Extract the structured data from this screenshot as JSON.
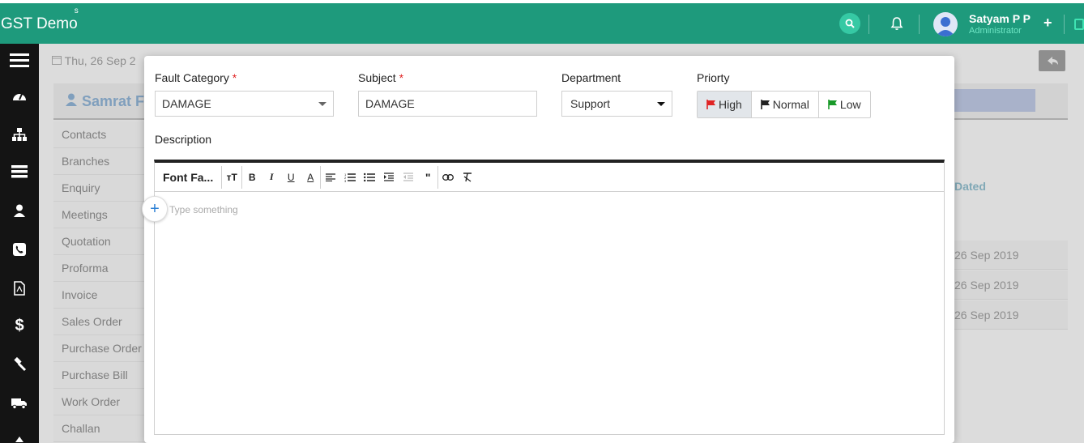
{
  "header": {
    "brand": "GST Demo",
    "brand_sup": "s",
    "user_name": "Satyam P P",
    "user_role": "Administrator",
    "accent": "#1e9a7c"
  },
  "sidebar": {
    "icons": [
      "menu-icon",
      "dashboard-icon",
      "sitemap-icon",
      "list-icon",
      "user-icon",
      "phone-icon",
      "pdf-icon",
      "dollar-icon",
      "gavel-icon",
      "truck-icon",
      "more-icon"
    ]
  },
  "background": {
    "date": "Thu, 26 Sep 2",
    "contact_name": "Samrat F",
    "menu": [
      "Contacts",
      "Branches",
      "Enquiry",
      "Meetings",
      "Quotation",
      "Proforma",
      "Invoice",
      "Sales Order",
      "Purchase Order",
      "Purchase Bill",
      "Work Order",
      "Challan"
    ],
    "table_header": "Dated",
    "rows": [
      "26 Sep 2019",
      "26 Sep 2019",
      "26 Sep 2019"
    ]
  },
  "modal": {
    "fault_category_label": "Fault Category",
    "fault_category_value": "DAMAGE",
    "subject_label": "Subject",
    "subject_value": "DAMAGE",
    "department_label": "Department",
    "department_value": "Support",
    "priority_label": "Priorty",
    "priority_options": [
      "High",
      "Normal",
      "Low"
    ],
    "priority_selected": "High",
    "required_mark": "*",
    "description_label": "Description",
    "toolbar_font": "Font Fa...",
    "editor_placeholder": "Type something",
    "colors": {
      "high": "#e02424",
      "normal": "#222222",
      "low": "#1a9a2a"
    }
  }
}
